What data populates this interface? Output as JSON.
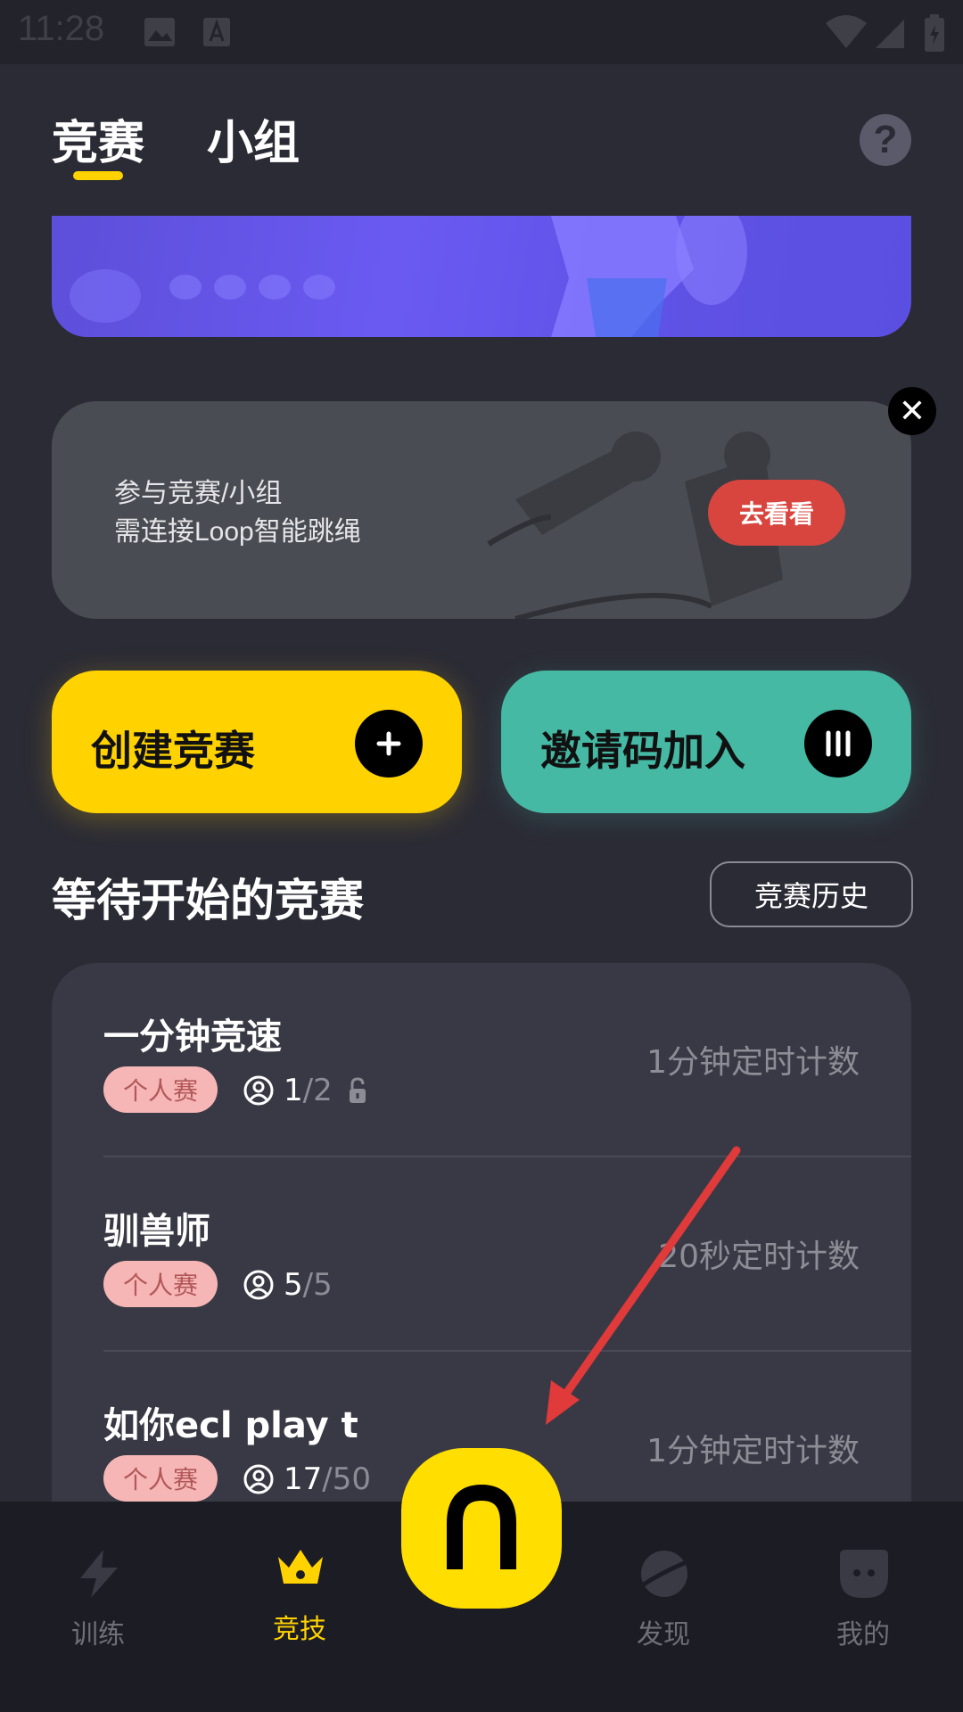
{
  "status_bar": {
    "time": "11:28"
  },
  "header": {
    "tabs": [
      {
        "label": "竞赛",
        "active": true
      },
      {
        "label": "小组",
        "active": false
      }
    ],
    "help_icon": "question-icon",
    "accent": "#ffd200"
  },
  "promo": {
    "line1": "参与竞赛/小组",
    "line2": "需连接Loop智能跳绳",
    "button": "去看看",
    "close_icon": "close-icon"
  },
  "actions": {
    "create_label": "创建竞赛",
    "create_icon": "plus-icon",
    "invite_label": "邀请码加入",
    "invite_icon": "code-bars-icon"
  },
  "section": {
    "title": "等待开始的竞赛",
    "history_button": "竞赛历史"
  },
  "competitions": [
    {
      "name": "一分钟竞速",
      "tag": "个人赛",
      "current": "1",
      "max": "2",
      "locked": true,
      "mode": "1分钟定时计数"
    },
    {
      "name": "驯兽师",
      "tag": "个人赛",
      "current": "5",
      "max": "5",
      "locked": false,
      "mode": "20秒定时计数"
    },
    {
      "name": "如你ecl play t",
      "tag": "个人赛",
      "current": "17",
      "max": "50",
      "locked": false,
      "mode": "1分钟定时计数"
    }
  ],
  "nav": {
    "items": [
      {
        "label": "训练",
        "icon": "lightning-icon",
        "active": false
      },
      {
        "label": "竞技",
        "icon": "crown-icon",
        "active": true
      },
      {
        "label": "发现",
        "icon": "planet-icon",
        "active": false
      },
      {
        "label": "我的",
        "icon": "face-icon",
        "active": false
      }
    ],
    "center_icon": "loop-logo-icon"
  }
}
